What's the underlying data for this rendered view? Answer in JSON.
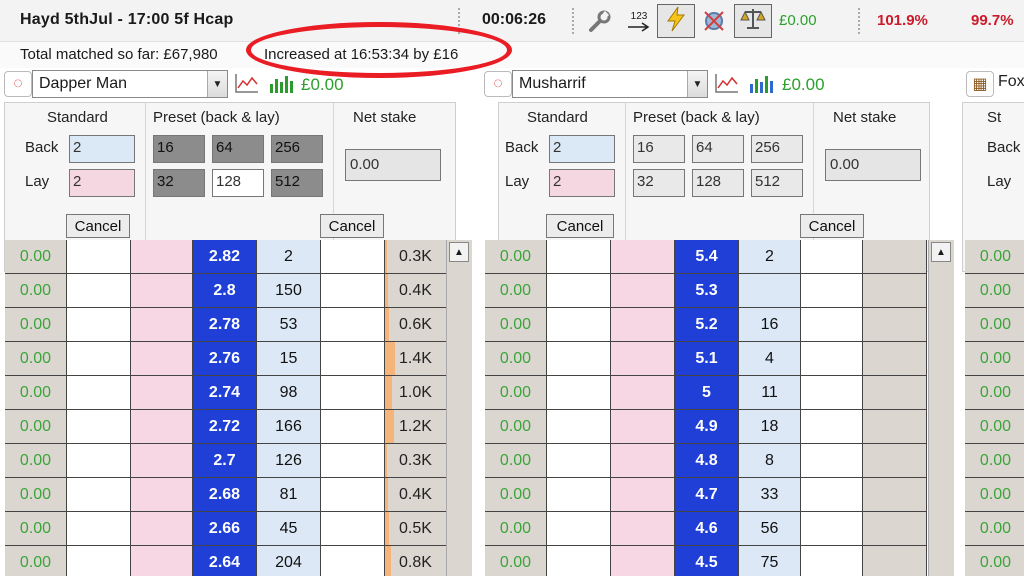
{
  "header": {
    "race_title": "Hayd 5thJul - 17:00 5f Hcap",
    "timer": "00:06:26",
    "ladder_icon_text": "123",
    "money": "£0.00",
    "pct_back": "101.9%",
    "pct_lay": "99.7%"
  },
  "info": {
    "matched": "Total matched so far: £67,980",
    "increased": "Increased at 16:53:34 by £16"
  },
  "labels": {
    "standard": "Standard",
    "preset": "Preset (back & lay)",
    "net_stake": "Net stake",
    "back": "Back",
    "lay": "Lay",
    "cancel": "Cancel"
  },
  "colors": {
    "accent_price": "#1f3fd6",
    "profit_green": "#2ca02c",
    "book_red": "#cc1a2a",
    "annotation_red": "#ea1c24"
  },
  "runners": [
    {
      "name": "Dapper Man",
      "money": "£0.00",
      "standard_back": "2",
      "standard_lay": "2",
      "presets_back": [
        "16",
        "64",
        "256"
      ],
      "presets_lay": [
        "32",
        "128",
        "512"
      ],
      "net_stake": "0.00",
      "ladder": [
        {
          "pl": "0.00",
          "price": "2.82",
          "vol": "2",
          "traded": "0.3K",
          "traded_frac": 0.2
        },
        {
          "pl": "0.00",
          "price": "2.8",
          "vol": "150",
          "traded": "0.4K",
          "traded_frac": 0.25
        },
        {
          "pl": "0.00",
          "price": "2.78",
          "vol": "53",
          "traded": "0.6K",
          "traded_frac": 0.4
        },
        {
          "pl": "0.00",
          "price": "2.76",
          "vol": "15",
          "traded": "1.4K",
          "traded_frac": 1.0
        },
        {
          "pl": "0.00",
          "price": "2.74",
          "vol": "98",
          "traded": "1.0K",
          "traded_frac": 0.7
        },
        {
          "pl": "0.00",
          "price": "2.72",
          "vol": "166",
          "traded": "1.2K",
          "traded_frac": 0.85
        },
        {
          "pl": "0.00",
          "price": "2.7",
          "vol": "126",
          "traded": "0.3K",
          "traded_frac": 0.2
        },
        {
          "pl": "0.00",
          "price": "2.68",
          "vol": "81",
          "traded": "0.4K",
          "traded_frac": 0.25
        },
        {
          "pl": "0.00",
          "price": "2.66",
          "vol": "45",
          "traded": "0.5K",
          "traded_frac": 0.35
        },
        {
          "pl": "0.00",
          "price": "2.64",
          "vol": "204",
          "traded": "0.8K",
          "traded_frac": 0.55
        }
      ]
    },
    {
      "name": "Musharrif",
      "money": "£0.00",
      "standard_back": "2",
      "standard_lay": "2",
      "presets_back": [
        "16",
        "64",
        "256"
      ],
      "presets_lay": [
        "32",
        "128",
        "512"
      ],
      "net_stake": "0.00",
      "ladder": [
        {
          "pl": "0.00",
          "price": "5.4",
          "vol": "2"
        },
        {
          "pl": "0.00",
          "price": "5.3",
          "vol": ""
        },
        {
          "pl": "0.00",
          "price": "5.2",
          "vol": "16"
        },
        {
          "pl": "0.00",
          "price": "5.1",
          "vol": "4"
        },
        {
          "pl": "0.00",
          "price": "5",
          "vol": "11"
        },
        {
          "pl": "0.00",
          "price": "4.9",
          "vol": "18"
        },
        {
          "pl": "0.00",
          "price": "4.8",
          "vol": "8"
        },
        {
          "pl": "0.00",
          "price": "4.7",
          "vol": "33"
        },
        {
          "pl": "0.00",
          "price": "4.6",
          "vol": "56"
        },
        {
          "pl": "0.00",
          "price": "4.5",
          "vol": "75"
        }
      ]
    },
    {
      "name_partial": "Fox",
      "standard_partial": "St",
      "back": "Back",
      "lay": "Lay",
      "ladder_pl": [
        "0.00",
        "0.00",
        "0.00",
        "0.00",
        "0.00",
        "0.00",
        "0.00",
        "0.00",
        "0.00",
        "0.00"
      ]
    }
  ]
}
